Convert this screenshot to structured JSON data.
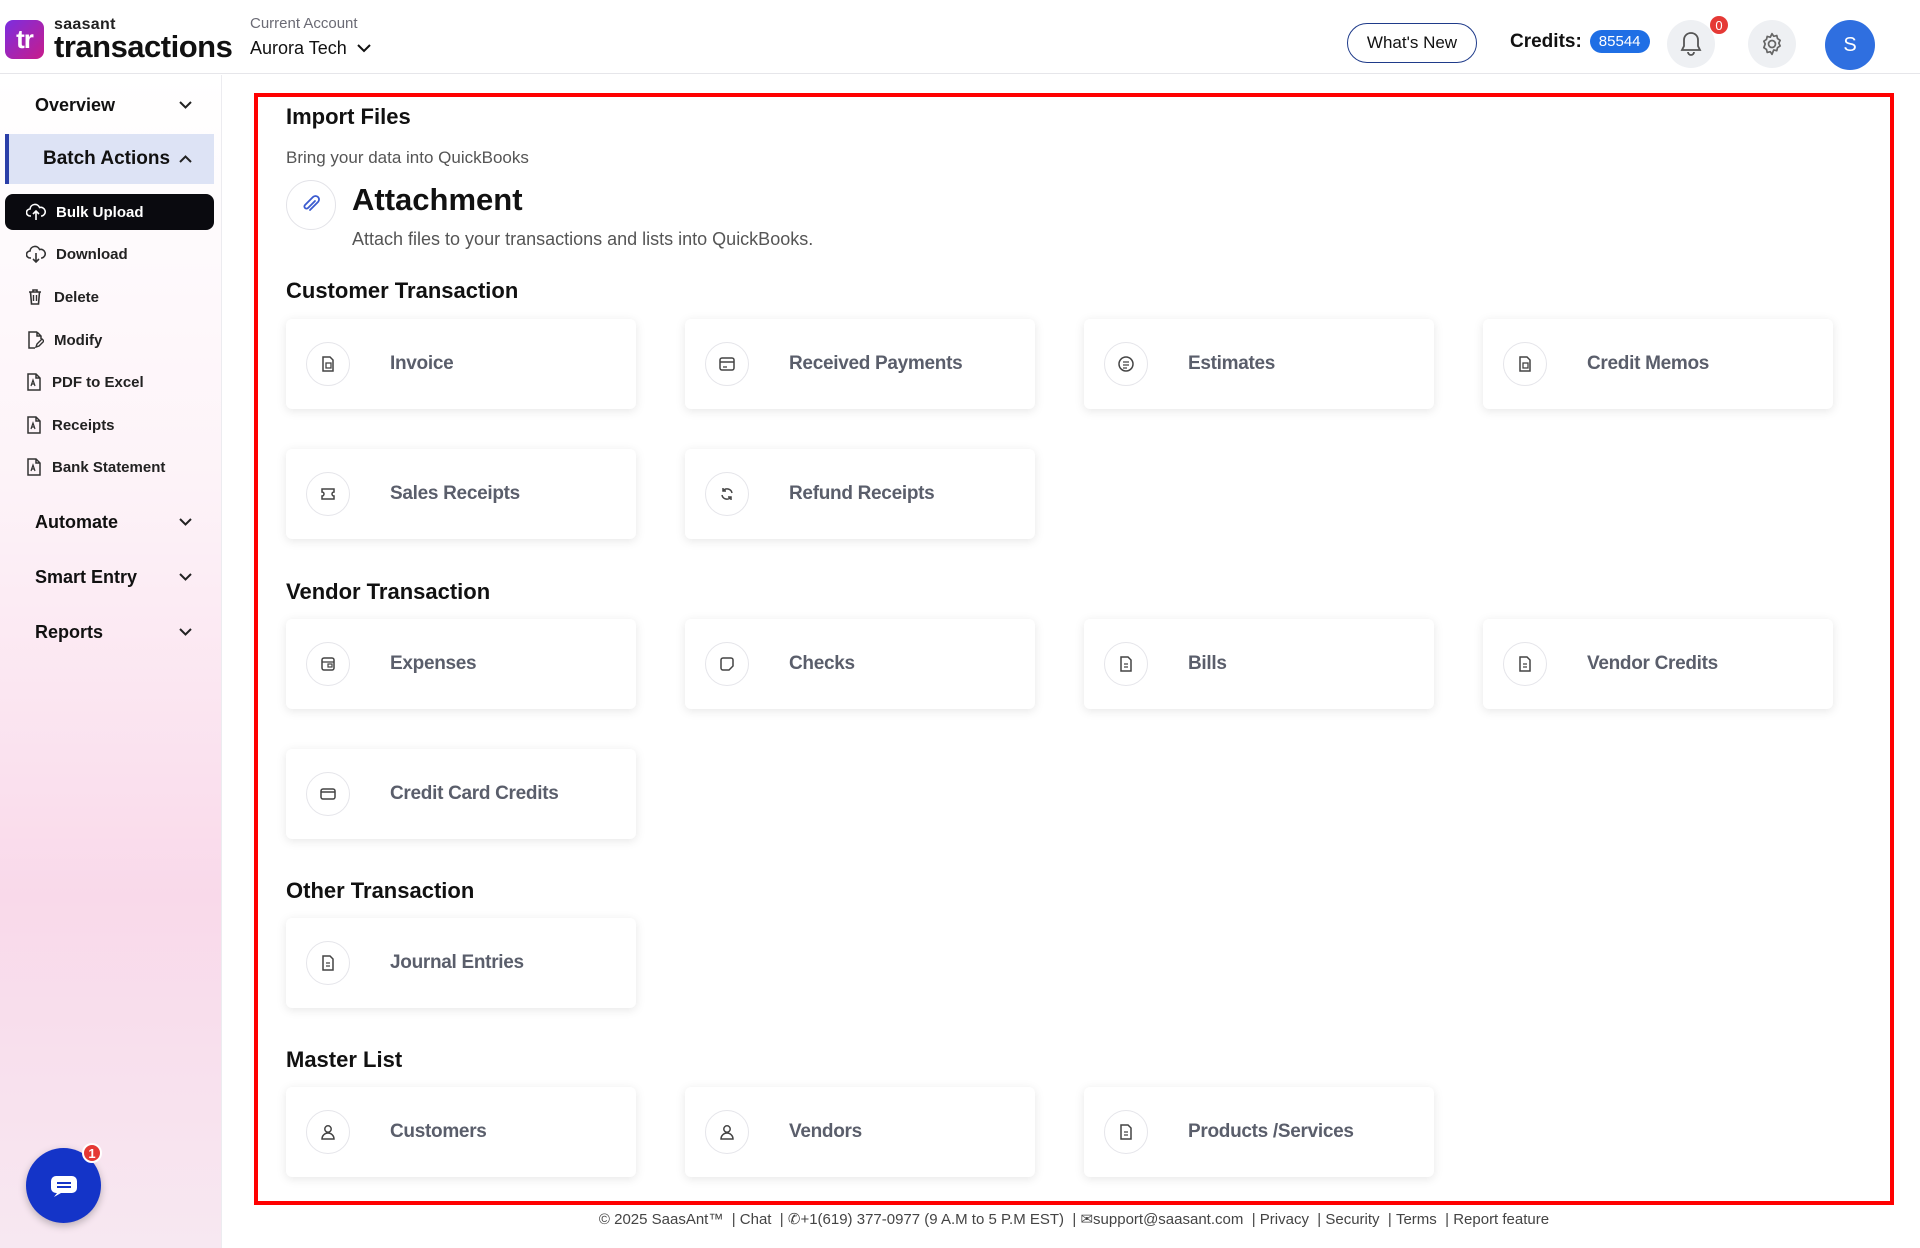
{
  "brand": {
    "logo_mark": "tr",
    "small": "saasant",
    "big": "transactions"
  },
  "account": {
    "label": "Current Account",
    "value": "Aurora Tech"
  },
  "header": {
    "whats_new": "What's New",
    "credits_label": "Credits:",
    "credits_value": "85544",
    "notifications_count": "0",
    "avatar_initial": "S"
  },
  "sidebar": {
    "overview": "Overview",
    "batch_actions": "Batch Actions",
    "items": [
      {
        "label": "Bulk Upload",
        "icon": "cloud-upload-icon"
      },
      {
        "label": "Download",
        "icon": "cloud-download-icon"
      },
      {
        "label": "Delete",
        "icon": "trash-icon"
      },
      {
        "label": "Modify",
        "icon": "edit-file-icon"
      },
      {
        "label": "PDF to Excel",
        "icon": "pdf-file-icon"
      },
      {
        "label": "Receipts",
        "icon": "pdf-file-icon"
      },
      {
        "label": "Bank Statement",
        "icon": "pdf-file-icon"
      }
    ],
    "automate": "Automate",
    "smart_entry": "Smart Entry",
    "reports": "Reports",
    "chat_count": "1"
  },
  "main": {
    "import_title": "Import Files",
    "import_sub": "Bring your data into QuickBooks",
    "attachment_title": "Attachment",
    "attachment_desc": "Attach files to your transactions and lists into QuickBooks.",
    "customer_title": "Customer Transaction",
    "customer_cards": [
      "Invoice",
      "Received Payments",
      "Estimates",
      "Credit Memos",
      "Sales Receipts",
      "Refund Receipts"
    ],
    "vendor_title": "Vendor Transaction",
    "vendor_cards": [
      "Expenses",
      "Checks",
      "Bills",
      "Vendor Credits",
      "Credit Card Credits"
    ],
    "other_title": "Other Transaction",
    "other_cards": [
      "Journal Entries"
    ],
    "master_title": "Master List",
    "master_cards": [
      "Customers",
      "Vendors",
      "Products /Services"
    ]
  },
  "footer": {
    "copyright": "© 2025 SaasAnt™",
    "chat": "Chat",
    "phone": "+1(619) 377-0977 (9 A.M to 5 P.M EST)",
    "email": "support@saasant.com",
    "privacy": "Privacy",
    "security": "Security",
    "terms": "Terms",
    "report": "Report feature"
  }
}
